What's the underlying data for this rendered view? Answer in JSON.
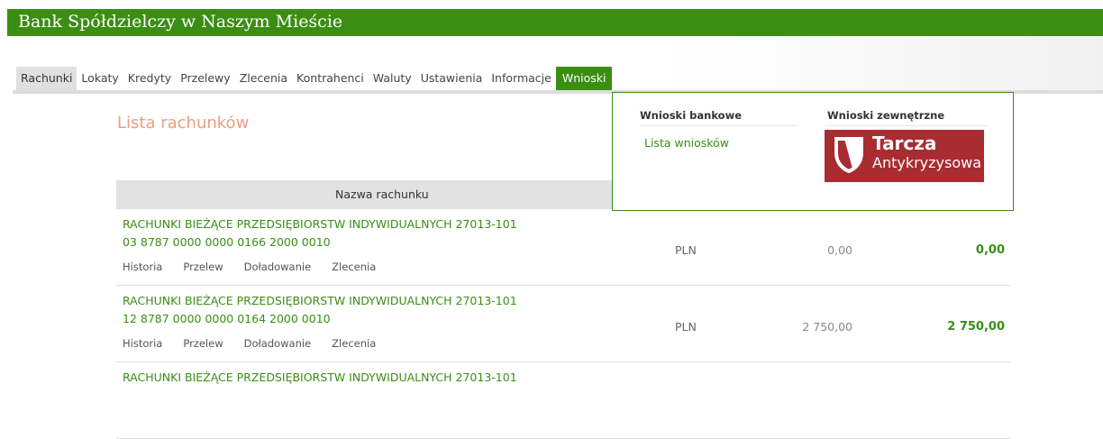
{
  "header": {
    "bank_name": "Bank Spółdzielczy w Naszym Mieście"
  },
  "nav": {
    "items": [
      "Rachunki",
      "Lokaty",
      "Kredyty",
      "Przelewy",
      "Zlecenia",
      "Kontrahenci",
      "Waluty",
      "Ustawienia",
      "Informacje",
      "Wnioski"
    ],
    "active": "Wnioski"
  },
  "page": {
    "title": "Lista rachunków"
  },
  "table": {
    "header_name": "Nazwa rachunku",
    "rows": [
      {
        "name": "RACHUNKI BIEŻĄCE PRZEDSIĘBIORSTW INDYWIDUALNYCH 27013-101",
        "number": "03 8787 0000 0000 0166 2000 0010",
        "links": [
          "Historia",
          "Przelew",
          "Doładowanie",
          "Zlecenia"
        ],
        "currency": "PLN",
        "balance": "0,00",
        "available": "0,00"
      },
      {
        "name": "RACHUNKI BIEŻĄCE PRZEDSIĘBIORSTW INDYWIDUALNYCH 27013-101",
        "number": "12 8787 0000 0000 0164 2000 0010",
        "links": [
          "Historia",
          "Przelew",
          "Doładowanie",
          "Zlecenia"
        ],
        "currency": "PLN",
        "balance": "2 750,00",
        "available": "2 750,00"
      },
      {
        "name": "RACHUNKI BIEŻĄCE PRZEDSIĘBIORSTW INDYWIDUALNYCH 27013-101"
      }
    ]
  },
  "dropdown": {
    "col1_header": "Wnioski bankowe",
    "col1_link": "Lista wniosków",
    "col2_header": "Wnioski zewnętrzne",
    "banner_line1": "Tarcza",
    "banner_line2": "Antykryzysowa"
  },
  "colors": {
    "brand_green": "#3b8e14",
    "title_orange": "#ec9e80",
    "tarcza_red": "#a92c31"
  },
  "icons": {
    "tarcza_logo": "shield-icon"
  }
}
